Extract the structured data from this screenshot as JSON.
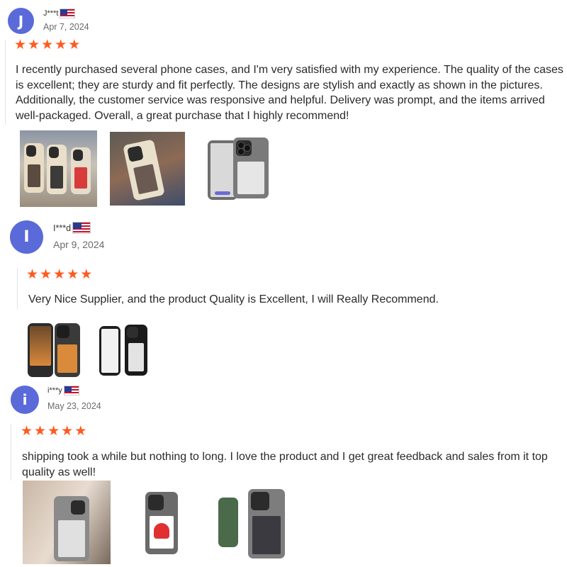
{
  "reviews": [
    {
      "avatar_letter": "J",
      "username": "J***t",
      "flag_icon": "us-flag-icon",
      "date": "Apr 7, 2024",
      "rating": 5,
      "text": "I recently purchased several phone cases, and I'm very satisfied with my experience. The quality of the cases is excellent; they are sturdy and fit perfectly. The designs are stylish and exactly as shown in the pictures. Additionally, the customer service was responsive and helpful. Delivery was prompt, and the items arrived well-packaged. Overall, a great purchase that I highly recommend!",
      "photo_count": 3
    },
    {
      "avatar_letter": "I",
      "username": "I***d",
      "flag_icon": "us-flag-icon",
      "date": "Apr 9, 2024",
      "rating": 5,
      "text": "Very Nice Supplier, and the product Quality is Excellent, I will Really Recommend.",
      "photo_count": 2
    },
    {
      "avatar_letter": "i",
      "username": "i***y",
      "flag_icon": "us-flag-icon",
      "date": "May 23, 2024",
      "rating": 5,
      "text": "shipping took a while but nothing to long. I love the product and I get great feedback and sales from it top quality as well!",
      "photo_count": 3
    }
  ],
  "colors": {
    "avatar": "#5a6ad9",
    "star": "#ff5a1f",
    "date": "#6b6b6b"
  }
}
